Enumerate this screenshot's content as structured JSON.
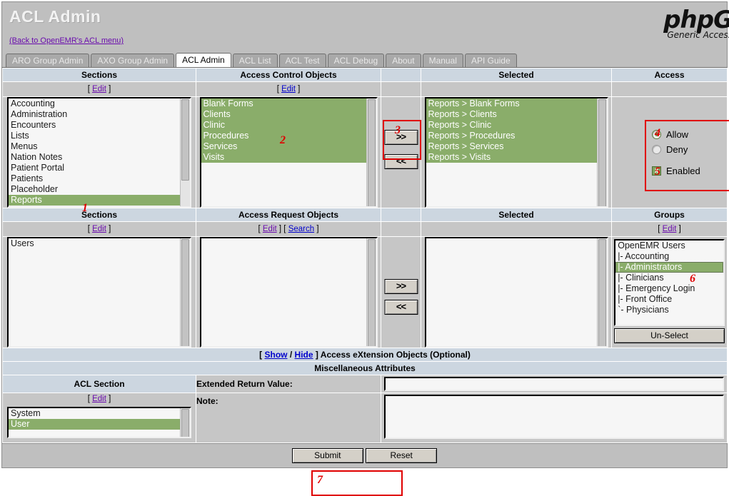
{
  "header": {
    "title": "ACL Admin",
    "back_link": "(Back to OpenEMR's ACL menu)",
    "logo_main": "phpG",
    "logo_sub": "Generic Access"
  },
  "tabs": [
    {
      "label": "ARO Group Admin",
      "active": false
    },
    {
      "label": "AXO Group Admin",
      "active": false
    },
    {
      "label": "ACL Admin",
      "active": true
    },
    {
      "label": "ACL List",
      "active": false
    },
    {
      "label": "ACL Test",
      "active": false
    },
    {
      "label": "ACL Debug",
      "active": false
    },
    {
      "label": "About",
      "active": false
    },
    {
      "label": "Manual",
      "active": false
    },
    {
      "label": "API Guide",
      "active": false
    }
  ],
  "row1": {
    "headers": {
      "sections": "Sections",
      "aco": "Access Control Objects",
      "middle": "",
      "selected": "Selected",
      "access": "Access"
    },
    "links": {
      "sections_edit": "Edit",
      "aco_edit": "Edit"
    },
    "sections_options": [
      {
        "label": "Accounting",
        "selected": false
      },
      {
        "label": "Administration",
        "selected": false
      },
      {
        "label": "Encounters",
        "selected": false
      },
      {
        "label": "Lists",
        "selected": false
      },
      {
        "label": "Menus",
        "selected": false
      },
      {
        "label": "Nation Notes",
        "selected": false
      },
      {
        "label": "Patient Portal",
        "selected": false
      },
      {
        "label": "Patients",
        "selected": false
      },
      {
        "label": "Placeholder",
        "selected": false
      },
      {
        "label": "Reports",
        "selected": true
      }
    ],
    "aco_options": [
      {
        "label": "Blank Forms",
        "selected": true
      },
      {
        "label": "Clients",
        "selected": true
      },
      {
        "label": "Clinic",
        "selected": true
      },
      {
        "label": "Procedures",
        "selected": true
      },
      {
        "label": "Services",
        "selected": true
      },
      {
        "label": "Visits",
        "selected": true
      }
    ],
    "selected_options": [
      {
        "label": "Reports > Blank Forms",
        "selected": true
      },
      {
        "label": "Reports > Clients",
        "selected": true
      },
      {
        "label": "Reports > Clinic",
        "selected": true
      },
      {
        "label": "Reports > Procedures",
        "selected": true
      },
      {
        "label": "Reports > Services",
        "selected": true
      },
      {
        "label": "Reports > Visits",
        "selected": true
      }
    ],
    "add_button": ">>",
    "remove_button": "<<",
    "access": {
      "allow_label": "Allow",
      "allow_checked": true,
      "deny_label": "Deny",
      "deny_checked": false,
      "enabled_label": "Enabled",
      "enabled_checked": true,
      "check_glyph": "x"
    }
  },
  "row2": {
    "headers": {
      "sections": "Sections",
      "aro": "Access Request Objects",
      "selected": "Selected",
      "groups": "Groups"
    },
    "links": {
      "sections_edit": "Edit",
      "aro_edit": "Edit",
      "aro_search": "Search",
      "groups_edit": "Edit"
    },
    "sections_options": [
      {
        "label": "Users",
        "selected": false
      }
    ],
    "aro_options": [],
    "selected_options": [],
    "groups_options": [
      {
        "label": "OpenEMR Users",
        "selected": false
      },
      {
        "label": "|- Accounting",
        "selected": false
      },
      {
        "label": "|- Administrators",
        "selected": true
      },
      {
        "label": "|- Clinicians",
        "selected": false
      },
      {
        "label": "|- Emergency Login",
        "selected": false
      },
      {
        "label": "|- Front Office",
        "selected": false
      },
      {
        "label": "`- Physicians",
        "selected": false
      }
    ],
    "add_button": ">>",
    "remove_button": "<<",
    "unselect_button": "Un-Select"
  },
  "axo": {
    "show_label": "Show",
    "hide_label": "Hide",
    "separator": "/",
    "text": "] Access eXtension Objects (Optional)",
    "open_bracket": "["
  },
  "misc": {
    "title": "Miscellaneous Attributes",
    "acl_section_header": "ACL Section",
    "acl_section_edit": "Edit",
    "acl_section_options": [
      {
        "label": "System",
        "selected": false
      },
      {
        "label": "User",
        "selected": true
      }
    ],
    "extended_return_label": "Extended Return Value:",
    "extended_return_value": "",
    "note_label": "Note:",
    "note_value": ""
  },
  "footer": {
    "submit_label": "Submit",
    "reset_label": "Reset"
  },
  "annotations": [
    {
      "id": "1",
      "text": "1"
    },
    {
      "id": "2",
      "text": "2"
    },
    {
      "id": "3",
      "text": "3"
    },
    {
      "id": "4",
      "text": "4"
    },
    {
      "id": "5",
      "text": "5"
    },
    {
      "id": "6",
      "text": "6"
    },
    {
      "id": "7",
      "text": "7"
    }
  ],
  "colors": {
    "selection_green": "#8aad6a",
    "annotation_red": "#e00000",
    "header_blue": "#ccd6e0",
    "link_blue": "#0000cc",
    "link_visited": "#6a0dad"
  }
}
